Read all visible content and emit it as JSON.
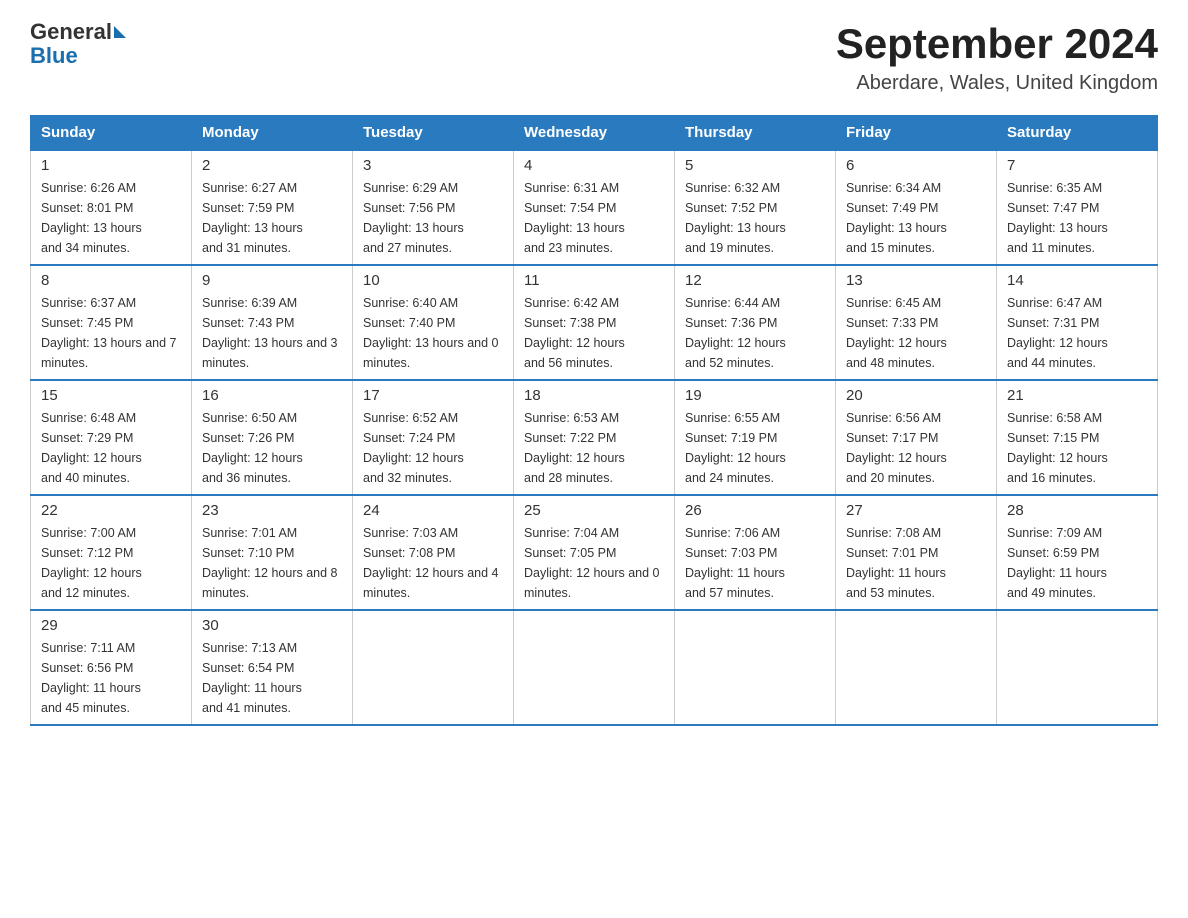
{
  "header": {
    "logo_general": "General",
    "logo_blue": "Blue",
    "month_year": "September 2024",
    "location": "Aberdare, Wales, United Kingdom"
  },
  "days_of_week": [
    "Sunday",
    "Monday",
    "Tuesday",
    "Wednesday",
    "Thursday",
    "Friday",
    "Saturday"
  ],
  "weeks": [
    [
      {
        "day": "1",
        "sunrise": "6:26 AM",
        "sunset": "8:01 PM",
        "daylight": "13 hours and 34 minutes."
      },
      {
        "day": "2",
        "sunrise": "6:27 AM",
        "sunset": "7:59 PM",
        "daylight": "13 hours and 31 minutes."
      },
      {
        "day": "3",
        "sunrise": "6:29 AM",
        "sunset": "7:56 PM",
        "daylight": "13 hours and 27 minutes."
      },
      {
        "day": "4",
        "sunrise": "6:31 AM",
        "sunset": "7:54 PM",
        "daylight": "13 hours and 23 minutes."
      },
      {
        "day": "5",
        "sunrise": "6:32 AM",
        "sunset": "7:52 PM",
        "daylight": "13 hours and 19 minutes."
      },
      {
        "day": "6",
        "sunrise": "6:34 AM",
        "sunset": "7:49 PM",
        "daylight": "13 hours and 15 minutes."
      },
      {
        "day": "7",
        "sunrise": "6:35 AM",
        "sunset": "7:47 PM",
        "daylight": "13 hours and 11 minutes."
      }
    ],
    [
      {
        "day": "8",
        "sunrise": "6:37 AM",
        "sunset": "7:45 PM",
        "daylight": "13 hours and 7 minutes."
      },
      {
        "day": "9",
        "sunrise": "6:39 AM",
        "sunset": "7:43 PM",
        "daylight": "13 hours and 3 minutes."
      },
      {
        "day": "10",
        "sunrise": "6:40 AM",
        "sunset": "7:40 PM",
        "daylight": "13 hours and 0 minutes."
      },
      {
        "day": "11",
        "sunrise": "6:42 AM",
        "sunset": "7:38 PM",
        "daylight": "12 hours and 56 minutes."
      },
      {
        "day": "12",
        "sunrise": "6:44 AM",
        "sunset": "7:36 PM",
        "daylight": "12 hours and 52 minutes."
      },
      {
        "day": "13",
        "sunrise": "6:45 AM",
        "sunset": "7:33 PM",
        "daylight": "12 hours and 48 minutes."
      },
      {
        "day": "14",
        "sunrise": "6:47 AM",
        "sunset": "7:31 PM",
        "daylight": "12 hours and 44 minutes."
      }
    ],
    [
      {
        "day": "15",
        "sunrise": "6:48 AM",
        "sunset": "7:29 PM",
        "daylight": "12 hours and 40 minutes."
      },
      {
        "day": "16",
        "sunrise": "6:50 AM",
        "sunset": "7:26 PM",
        "daylight": "12 hours and 36 minutes."
      },
      {
        "day": "17",
        "sunrise": "6:52 AM",
        "sunset": "7:24 PM",
        "daylight": "12 hours and 32 minutes."
      },
      {
        "day": "18",
        "sunrise": "6:53 AM",
        "sunset": "7:22 PM",
        "daylight": "12 hours and 28 minutes."
      },
      {
        "day": "19",
        "sunrise": "6:55 AM",
        "sunset": "7:19 PM",
        "daylight": "12 hours and 24 minutes."
      },
      {
        "day": "20",
        "sunrise": "6:56 AM",
        "sunset": "7:17 PM",
        "daylight": "12 hours and 20 minutes."
      },
      {
        "day": "21",
        "sunrise": "6:58 AM",
        "sunset": "7:15 PM",
        "daylight": "12 hours and 16 minutes."
      }
    ],
    [
      {
        "day": "22",
        "sunrise": "7:00 AM",
        "sunset": "7:12 PM",
        "daylight": "12 hours and 12 minutes."
      },
      {
        "day": "23",
        "sunrise": "7:01 AM",
        "sunset": "7:10 PM",
        "daylight": "12 hours and 8 minutes."
      },
      {
        "day": "24",
        "sunrise": "7:03 AM",
        "sunset": "7:08 PM",
        "daylight": "12 hours and 4 minutes."
      },
      {
        "day": "25",
        "sunrise": "7:04 AM",
        "sunset": "7:05 PM",
        "daylight": "12 hours and 0 minutes."
      },
      {
        "day": "26",
        "sunrise": "7:06 AM",
        "sunset": "7:03 PM",
        "daylight": "11 hours and 57 minutes."
      },
      {
        "day": "27",
        "sunrise": "7:08 AM",
        "sunset": "7:01 PM",
        "daylight": "11 hours and 53 minutes."
      },
      {
        "day": "28",
        "sunrise": "7:09 AM",
        "sunset": "6:59 PM",
        "daylight": "11 hours and 49 minutes."
      }
    ],
    [
      {
        "day": "29",
        "sunrise": "7:11 AM",
        "sunset": "6:56 PM",
        "daylight": "11 hours and 45 minutes."
      },
      {
        "day": "30",
        "sunrise": "7:13 AM",
        "sunset": "6:54 PM",
        "daylight": "11 hours and 41 minutes."
      },
      null,
      null,
      null,
      null,
      null
    ]
  ],
  "labels": {
    "sunrise": "Sunrise:",
    "sunset": "Sunset:",
    "daylight": "Daylight:"
  }
}
